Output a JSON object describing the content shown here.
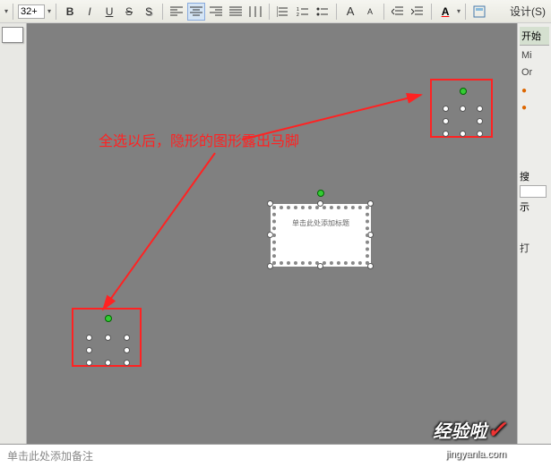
{
  "toolbar": {
    "font_size": "32+",
    "bold": "B",
    "italic": "I",
    "underline": "U",
    "strike": "S",
    "shadow": "S",
    "sub": "A",
    "sup": "A",
    "design": "设计(S)"
  },
  "right_panel": {
    "header": "开始",
    "mi": "Mi",
    "or": "Or",
    "search_label": "搜",
    "show_label": "示",
    "open_label": "打"
  },
  "annotation": {
    "text": "全选以后，隐形的图形露出马脚"
  },
  "textbox": {
    "content": "单击此处添加标题"
  },
  "notes": {
    "placeholder": "单击此处添加备注"
  },
  "watermark": {
    "main": "经验啦",
    "sub": "jingyanla.com"
  }
}
